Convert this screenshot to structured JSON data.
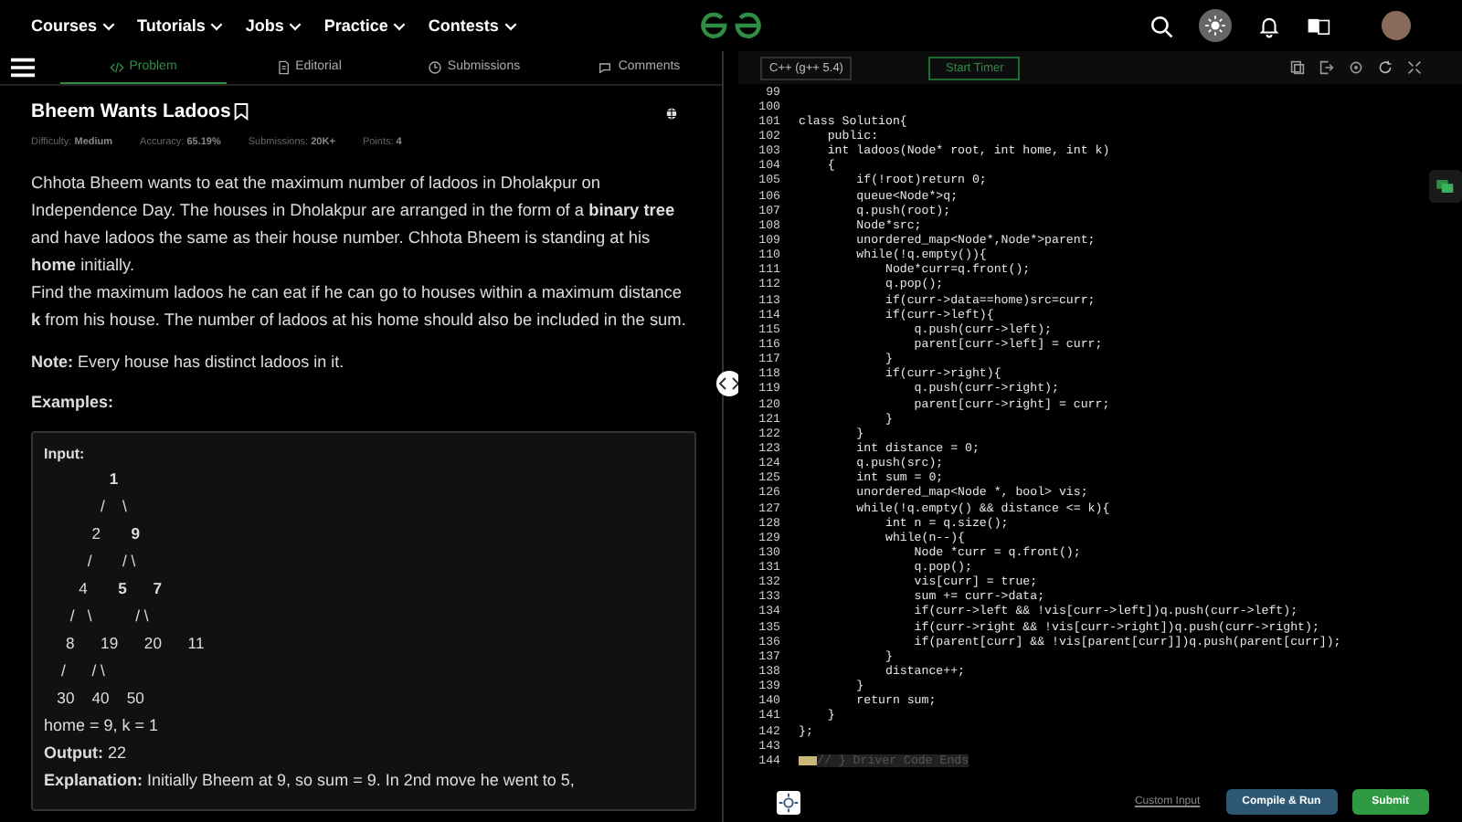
{
  "nav": {
    "items": [
      "Courses",
      "Tutorials",
      "Jobs",
      "Practice",
      "Contests"
    ]
  },
  "tabs": [
    {
      "label": "Problem",
      "kind": "code",
      "selected": true
    },
    {
      "label": "Editorial",
      "kind": "doc",
      "selected": false
    },
    {
      "label": "Submissions",
      "kind": "clock",
      "selected": false
    },
    {
      "label": "Comments",
      "kind": "comment",
      "selected": false
    }
  ],
  "problem": {
    "title": "Bheem Wants Ladoos",
    "meta": [
      {
        "label": "Difficulty:",
        "value": "Medium"
      },
      {
        "label": "Accuracy:",
        "value": "65.19%"
      },
      {
        "label": "Submissions:",
        "value": "20K+"
      },
      {
        "label": "Points:",
        "value": "4"
      }
    ],
    "paragraphs": [
      "Chhota Bheem wants to eat the maximum number of ladoos in Dholakpur on Independence Day. The houses in Dholakpur are arranged in the form of a **binary tree** and have ladoos the same as their house number. Chhota Bheem is standing at his",
      "**home** initially.",
      "Find the maximum ladoos he can eat if he can go to houses within a maximum distance **k** from his house. The number of ladoos at his home should also be included in the sum."
    ],
    "note": "**Note:** Every house has distinct ladoos in it.",
    "examples_heading": "Examples:",
    "example": {
      "heading": "Input:",
      "tree": [
        "               **1**",
        "             /    \\",
        "           2       **9**",
        "          /       / \\",
        "        4       **5**      **7**",
        "      /   \\          / \\",
        "     8      19      20      11",
        "    /      / \\",
        "   30    40    50"
      ],
      "lines": [
        "home = 9, k = 1",
        "**Output:** 22",
        "**Explanation:** Initially Bheem at 9, so sum = 9. In 2nd move he went to 5,"
      ]
    }
  },
  "editor": {
    "language": "C++ (g++ 5.4)",
    "timer": "Start Timer",
    "lines": [
      {
        "n": "99"
      },
      {
        "n": "100"
      },
      {
        "n": "101",
        "code": "class Solution{",
        "kind": "plain"
      },
      {
        "n": "102",
        "code": "    public:",
        "kind": "plain"
      },
      {
        "n": "103",
        "code": "    int ladoos(Node* root, int home, int k)",
        "kind": "plain"
      },
      {
        "n": "104",
        "code": "    {",
        "kind": "plain"
      },
      {
        "n": "105",
        "code": "        if(!root)return 0;",
        "kind": "plain"
      },
      {
        "n": "106",
        "code": "        queue<Node*>q;",
        "kind": "plain"
      },
      {
        "n": "107",
        "code": "        q.push(root);",
        "kind": "plain"
      },
      {
        "n": "108",
        "code": "        Node*src;",
        "kind": "plain"
      },
      {
        "n": "109",
        "code": "        unordered_map<Node*,Node*>parent;",
        "kind": "plain"
      },
      {
        "n": "110",
        "code": "        while(!q.empty()){",
        "kind": "plain"
      },
      {
        "n": "111",
        "code": "            Node*curr=q.front();",
        "kind": "plain"
      },
      {
        "n": "112",
        "code": "            q.pop();",
        "kind": "plain"
      },
      {
        "n": "113",
        "code": "            if(curr->data==home)src=curr;",
        "kind": "plain"
      },
      {
        "n": "114",
        "code": "            if(curr->left){",
        "kind": "plain"
      },
      {
        "n": "115",
        "code": "                q.push(curr->left);",
        "kind": "plain"
      },
      {
        "n": "116",
        "code": "                parent[curr->left] = curr;",
        "kind": "plain"
      },
      {
        "n": "117",
        "code": "            }",
        "kind": "plain"
      },
      {
        "n": "118",
        "code": "            if(curr->right){",
        "kind": "plain"
      },
      {
        "n": "119",
        "code": "                q.push(curr->right);",
        "kind": "plain"
      },
      {
        "n": "120",
        "code": "                parent[curr->right] = curr;",
        "kind": "plain"
      },
      {
        "n": "121",
        "code": "            }",
        "kind": "plain"
      },
      {
        "n": "122",
        "code": "        }",
        "kind": "plain"
      },
      {
        "n": "123",
        "code": "        int distance = 0;",
        "kind": "plain"
      },
      {
        "n": "124",
        "code": "        q.push(src);",
        "kind": "plain"
      },
      {
        "n": "125",
        "code": "        int sum = 0;",
        "kind": "plain"
      },
      {
        "n": "126",
        "code": "        unordered_map<Node *, bool> vis;",
        "kind": "plain"
      },
      {
        "n": "127",
        "code": "        while(!q.empty() && distance <= k){",
        "kind": "plain"
      },
      {
        "n": "128",
        "code": "            int n = q.size();",
        "kind": "plain"
      },
      {
        "n": "129",
        "code": "            while(n--){",
        "kind": "plain"
      },
      {
        "n": "130",
        "code": "                Node *curr = q.front();",
        "kind": "plain"
      },
      {
        "n": "131",
        "code": "                q.pop();",
        "kind": "plain"
      },
      {
        "n": "132",
        "code": "                vis[curr] = true;",
        "kind": "plain"
      },
      {
        "n": "133",
        "code": "                sum += curr->data;",
        "kind": "plain"
      },
      {
        "n": "134",
        "code": "                if(curr->left && !vis[curr->left])q.push(curr->left);",
        "kind": "plain"
      },
      {
        "n": "135",
        "code": "                if(curr->right && !vis[curr->right])q.push(curr->right);",
        "kind": "plain"
      },
      {
        "n": "136",
        "code": "                if(parent[curr] && !vis[parent[curr]])q.push(parent[curr]);",
        "kind": "plain"
      },
      {
        "n": "137",
        "code": "            }",
        "kind": "plain"
      },
      {
        "n": "138",
        "code": "            distance++;",
        "kind": "plain"
      },
      {
        "n": "139",
        "code": "        }",
        "kind": "plain"
      },
      {
        "n": "140",
        "code": "        return sum;",
        "kind": "plain"
      },
      {
        "n": "141",
        "code": "    }",
        "kind": "plain"
      },
      {
        "n": "142",
        "code": "};",
        "kind": "plain"
      },
      {
        "n": "143"
      },
      {
        "n": "144",
        "code": "// } Driver Code Ends",
        "kind": "folded"
      }
    ],
    "custom_input": "Custom Input",
    "compile": "Compile & Run",
    "submit": "Submit"
  }
}
